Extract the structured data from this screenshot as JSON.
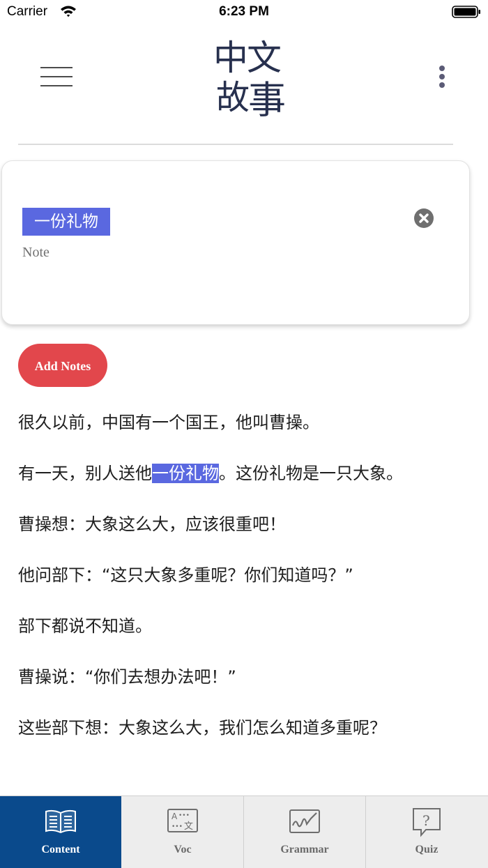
{
  "status_bar": {
    "carrier": "Carrier",
    "time": "6:23 PM"
  },
  "header": {
    "logo_icon": "zhongwen-gushi-calligraphy-logo",
    "logo_characters": "中文故事",
    "menu_icon": "hamburger-menu-icon",
    "more_icon": "vertical-ellipsis-icon"
  },
  "note_card": {
    "word": "一份礼物",
    "note_label": "Note",
    "close_icon": "close-circle-icon"
  },
  "add_notes_label": "Add Notes",
  "story": {
    "p1": "很久以前，中国有一个国王，他叫曹操。",
    "p2_before": "有一天，别人送他",
    "p2_highlight": "一份礼物",
    "p2_after": "。这份礼物是一只大象。",
    "p3": "曹操想：大象这么大，应该很重吧！",
    "p4": "他问部下：“这只大象多重呢？你们知道吗？”",
    "p5": "部下都说不知道。",
    "p6": "曹操说：“你们去想办法吧！”",
    "p7": "这些部下想：大象这么大，我们怎么知道多重呢？"
  },
  "tabs": [
    {
      "label": "Content",
      "icon": "open-book-icon",
      "active": true
    },
    {
      "label": "Voc",
      "icon": "translate-card-icon",
      "active": false
    },
    {
      "label": "Grammar",
      "icon": "signature-chart-icon",
      "active": false
    },
    {
      "label": "Quiz",
      "icon": "question-bubble-icon",
      "active": false
    }
  ],
  "colors": {
    "highlight": "#5a68e0",
    "add_notes": "#e2474c",
    "tab_active": "#0a4a8c",
    "tab_bar": "#ededed"
  }
}
